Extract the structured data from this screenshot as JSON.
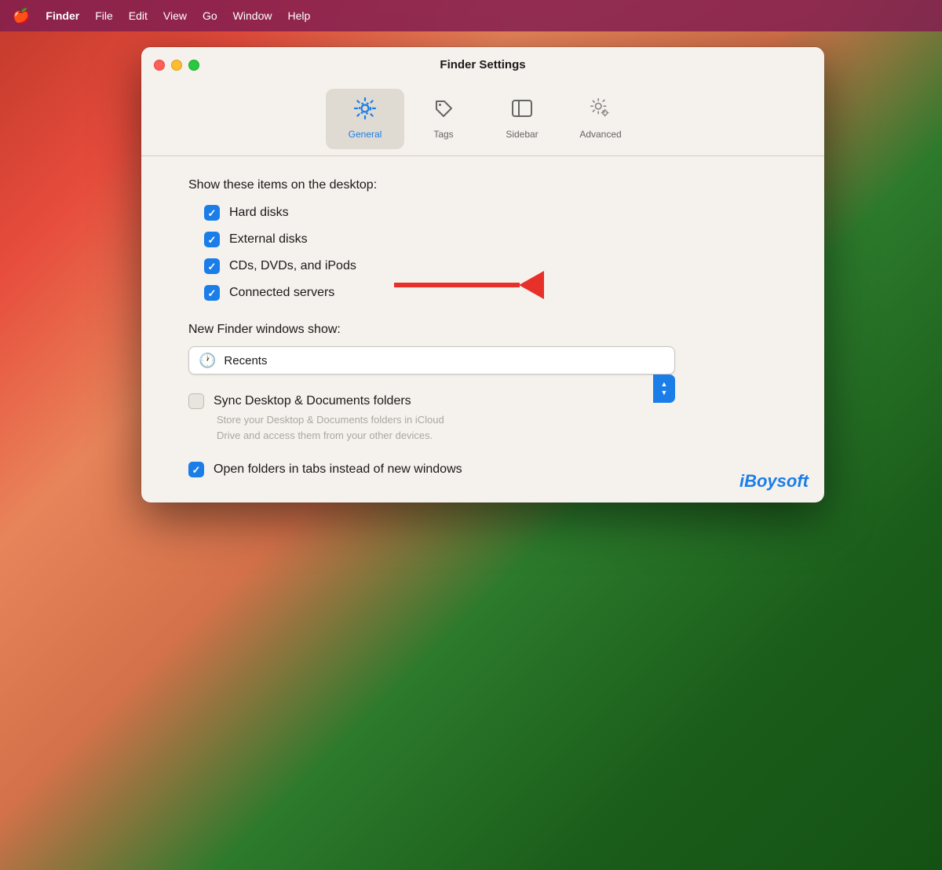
{
  "menubar": {
    "apple": "🍎",
    "items": [
      "Finder",
      "File",
      "Edit",
      "View",
      "Go",
      "Window",
      "Help"
    ]
  },
  "window": {
    "title": "Finder Settings",
    "tabs": [
      {
        "id": "general",
        "label": "General",
        "active": true
      },
      {
        "id": "tags",
        "label": "Tags",
        "active": false
      },
      {
        "id": "sidebar",
        "label": "Sidebar",
        "active": false
      },
      {
        "id": "advanced",
        "label": "Advanced",
        "active": false
      }
    ]
  },
  "content": {
    "desktop_section_label": "Show these items on the desktop:",
    "checkboxes_desktop": [
      {
        "id": "hard-disks",
        "label": "Hard disks",
        "checked": true
      },
      {
        "id": "external-disks",
        "label": "External disks",
        "checked": true
      },
      {
        "id": "cds-dvds",
        "label": "CDs, DVDs, and iPods",
        "checked": true
      },
      {
        "id": "connected-servers",
        "label": "Connected servers",
        "checked": true
      }
    ],
    "new_windows_label": "New Finder windows show:",
    "dropdown_value": "Recents",
    "sync_checkbox": {
      "id": "sync-desktop",
      "label": "Sync Desktop & Documents folders",
      "checked": false
    },
    "sync_subtext": "Store your Desktop & Documents folders in iCloud\nDrive and access them from your other devices.",
    "open_folders_checkbox": {
      "id": "open-folders",
      "label": "Open folders in tabs instead of new windows",
      "checked": true
    }
  },
  "watermark": {
    "prefix": "i",
    "brand": "Boysoft"
  }
}
